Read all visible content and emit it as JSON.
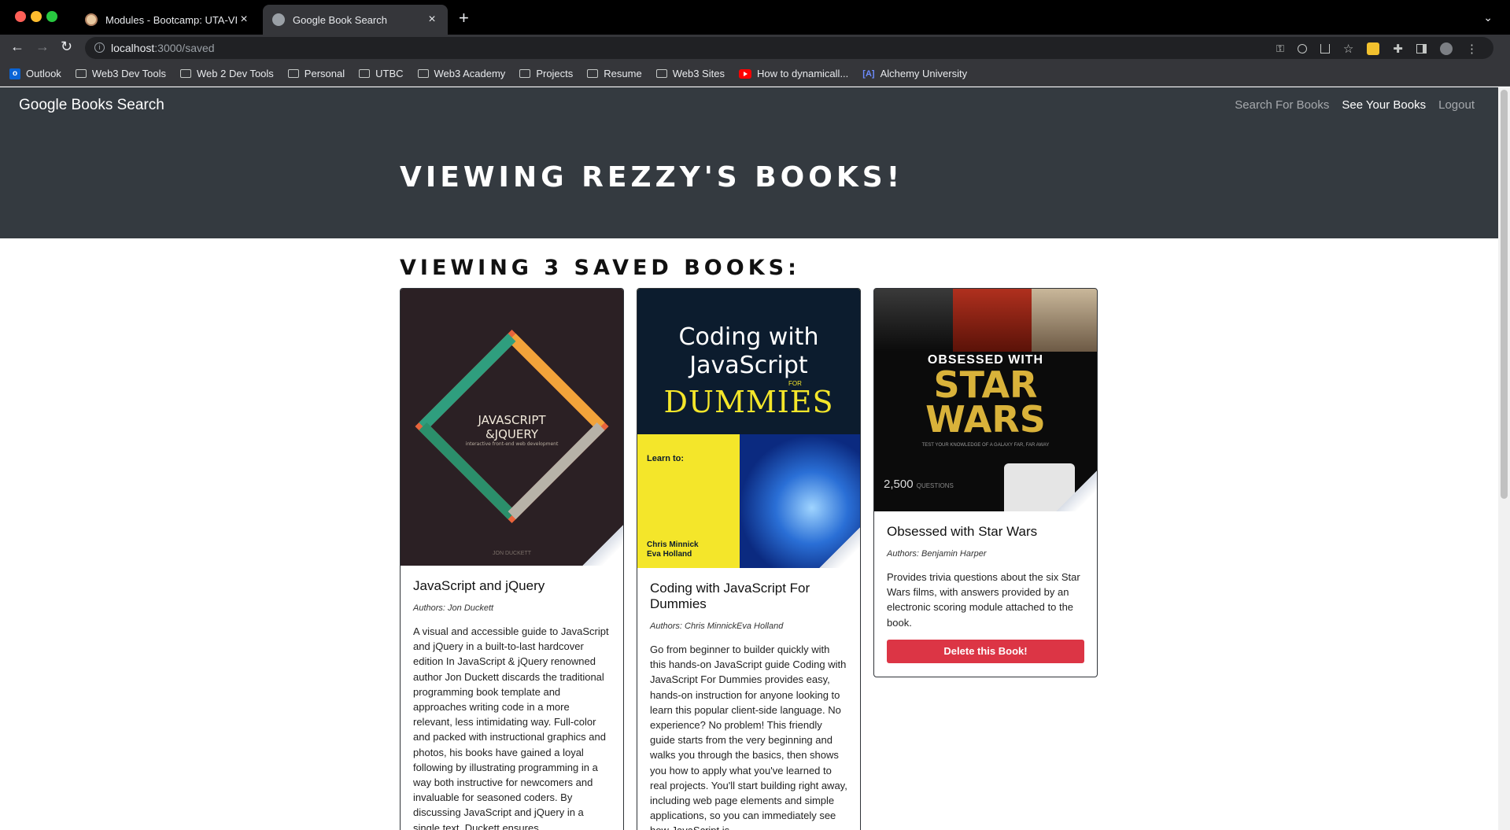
{
  "browser": {
    "tabs": [
      {
        "title": "Modules - Bootcamp: UTA-VIR",
        "active": false
      },
      {
        "title": "Google Book Search",
        "active": true
      }
    ],
    "new_tab": "+",
    "url_host": "localhost",
    "url_path": ":3000/saved",
    "bookmarks": [
      {
        "label": "Outlook",
        "icon": "outlook-icon"
      },
      {
        "label": "Web3 Dev Tools",
        "icon": "folder-icon"
      },
      {
        "label": "Web 2 Dev Tools",
        "icon": "folder-icon"
      },
      {
        "label": "Personal",
        "icon": "folder-icon"
      },
      {
        "label": "UTBC",
        "icon": "folder-icon"
      },
      {
        "label": "Web3 Academy",
        "icon": "folder-icon"
      },
      {
        "label": "Projects",
        "icon": "folder-icon"
      },
      {
        "label": "Resume",
        "icon": "folder-icon"
      },
      {
        "label": "Web3 Sites",
        "icon": "folder-icon"
      },
      {
        "label": "How to dynamicall...",
        "icon": "youtube-icon"
      },
      {
        "label": "Alchemy University",
        "icon": "alchemy-icon"
      }
    ]
  },
  "app": {
    "brand": "Google Books Search",
    "nav": {
      "search": "Search For Books",
      "saved": "See Your Books",
      "logout": "Logout"
    },
    "hero_title": "Viewing Rezzy's books!",
    "saved_title": "Viewing 3 saved books:"
  },
  "books": [
    {
      "title": "JavaScript and jQuery",
      "authors": "Authors: Jon Duckett",
      "description": "A visual and accessible guide to JavaScript and jQuery in a built-to-last hardcover edition In JavaScript & jQuery renowned author Jon Duckett discards the traditional programming book template and approaches writing code in a more relevant, less intimidating way. Full-color and packed with instructional graphics and photos, his books have gained a loyal following by illustrating programming in a way both instructive for newcomers and invaluable for seasoned coders. By discussing JavaScript and jQuery in a single text, Duckett ensures",
      "cover": {
        "line1": "JAVASCRIPT",
        "line2": "&JQUERY",
        "sub": "interactive front-end web development",
        "author": "JON DUCKETT"
      }
    },
    {
      "title": "Coding with JavaScript For Dummies",
      "authors": "Authors: Chris MinnickEva Holland",
      "description": "Go from beginner to builder quickly with this hands-on JavaScript guide Coding with JavaScript For Dummies provides easy, hands-on instruction for anyone looking to learn this popular client-side language. No experience? No problem! This friendly guide starts from the very beginning and walks you through the basics, then shows you how to apply what you've learned to real projects. You'll start building right away, including web page elements and simple applications, so you can immediately see how JavaScript is",
      "cover": {
        "top": "Learn to:",
        "line1": "Coding with",
        "line2": "JavaScript",
        "for": "FOR",
        "dummies": "DUMMIES",
        "author1": "Chris Minnick",
        "author2": "Eva Holland"
      }
    },
    {
      "title": "Obsessed with Star Wars",
      "authors": "Authors: Benjamin Harper",
      "description": "Provides trivia questions about the six Star Wars films, with answers provided by an electronic scoring module attached to the book.",
      "button": "Delete this Book!",
      "cover": {
        "line1": "OBSESSED WITH",
        "star": "STAR",
        "wars": "WARS",
        "tag": "TEST YOUR KNOWLEDGE OF A GALAXY FAR, FAR AWAY",
        "questions": "2,500",
        "questions_label": "QUESTIONS"
      }
    }
  ],
  "colors": {
    "nav_bg": "#343a40",
    "danger": "#dc3545",
    "chrome_bg": "#35363a"
  }
}
